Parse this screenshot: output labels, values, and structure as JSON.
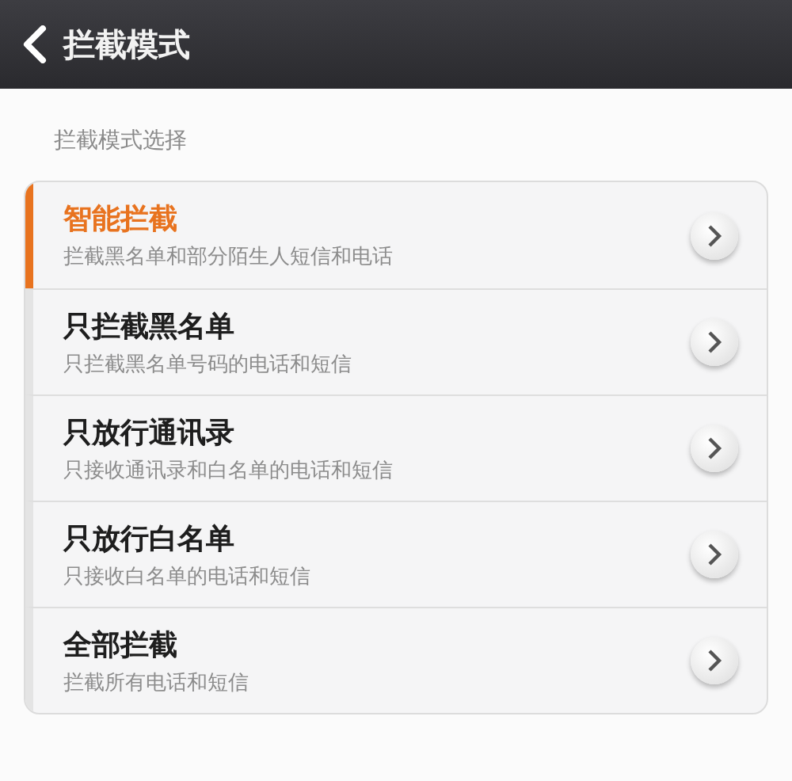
{
  "header": {
    "title": "拦截模式"
  },
  "section_label": "拦截模式选择",
  "modes": [
    {
      "title": "智能拦截",
      "description": "拦截黑名单和部分陌生人短信和电话",
      "selected": true
    },
    {
      "title": "只拦截黑名单",
      "description": "只拦截黑名单号码的电话和短信",
      "selected": false
    },
    {
      "title": "只放行通讯录",
      "description": "只接收通讯录和白名单的电话和短信",
      "selected": false
    },
    {
      "title": "只放行白名单",
      "description": "只接收白名单的电话和短信",
      "selected": false
    },
    {
      "title": "全部拦截",
      "description": "拦截所有电话和短信",
      "selected": false
    }
  ]
}
